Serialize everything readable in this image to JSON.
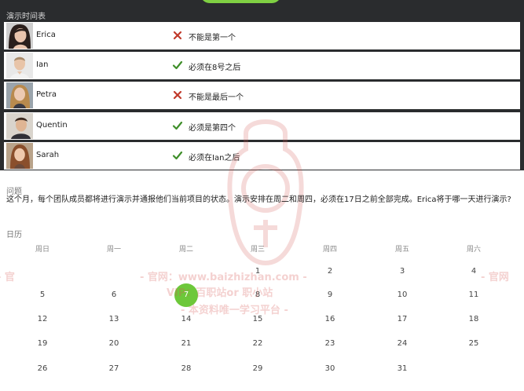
{
  "schedule": {
    "title": "演示时间表",
    "rows": [
      {
        "name": "Erica",
        "status": "cross",
        "condition": "不能是第一个"
      },
      {
        "name": "Ian",
        "status": "check",
        "condition": "必须在8号之后"
      },
      {
        "name": "Petra",
        "status": "cross",
        "condition": "不能是最后一个"
      },
      {
        "name": "Quentin",
        "status": "check",
        "condition": "必须是第四个"
      },
      {
        "name": "Sarah",
        "status": "check",
        "condition": "必须在Ian之后"
      }
    ]
  },
  "question": {
    "label": "问题",
    "text": "这个月，每个团队成员都将进行演示并通报他们当前项目的状态。演示安排在周二和周四，必须在17日之前全部完成。Erica将于哪一天进行演示?"
  },
  "calendar": {
    "label": "日历",
    "weekdays": [
      "周日",
      "周一",
      "周二",
      "周三",
      "周四",
      "周五",
      "周六"
    ],
    "weeks": [
      [
        "",
        "",
        "",
        "1",
        "2",
        "3",
        "4"
      ],
      [
        "5",
        "6",
        "7",
        "8",
        "9",
        "10",
        "11"
      ],
      [
        "12",
        "13",
        "14",
        "15",
        "16",
        "17",
        "18"
      ],
      [
        "19",
        "20",
        "21",
        "22",
        "23",
        "24",
        "25"
      ],
      [
        "26",
        "27",
        "28",
        "29",
        "30",
        "31",
        ""
      ]
    ],
    "selected_day": "7"
  },
  "watermark": {
    "line1": "- 官网：www.baizhizhan.com -",
    "line2": "VIP：百职站or 职小站",
    "line3": "- 本资料唯一学习平台 -",
    "edge_left": "- 官",
    "edge_right": "- 官网"
  },
  "colors": {
    "accent": "#6dc83a",
    "cross": "#c0392b",
    "check": "#3f8f2a",
    "dark_panel": "#2a2c2e"
  }
}
